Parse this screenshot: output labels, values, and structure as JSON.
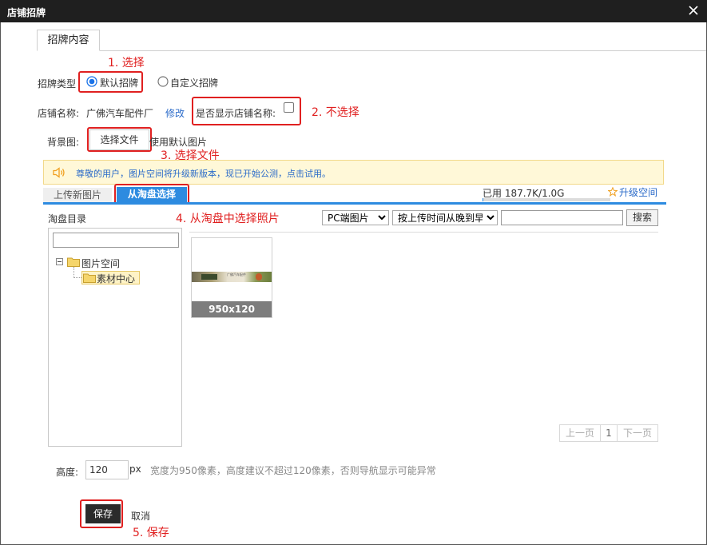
{
  "dialog": {
    "title": "店铺招牌"
  },
  "tabs": {
    "content": "招牌内容"
  },
  "sign_type": {
    "label": "招牌类型",
    "option_default": "默认招牌",
    "option_custom": "自定义招牌"
  },
  "store_name": {
    "label": "店铺名称:",
    "value": "广佛汽车配件厂",
    "edit": "修改",
    "show_label": "是否显示店铺名称:"
  },
  "background": {
    "label": "背景图:",
    "choose_file": "选择文件",
    "use_default": "使用默认图片"
  },
  "notice": {
    "text": "尊敬的用户，图片空间将升级新版本，现已开始公测，点击试用。"
  },
  "subtabs": {
    "upload": "上传新图片",
    "from_taobao": "从淘盘选择"
  },
  "usage": {
    "text": "已用 187.7K/1.0G",
    "fraction": 0.0002,
    "upgrade": "升级空间"
  },
  "directory": {
    "title": "淘盘目录",
    "root": "图片空间",
    "child": "素材中心"
  },
  "filters": {
    "type_selected": "PC端图片",
    "sort_selected": "按上传时间从晚到早",
    "search_button": "搜索"
  },
  "thumbnail": {
    "caption": "950x120",
    "banner_text": "广佛汽车配件"
  },
  "pager": {
    "prev": "上一页",
    "page": "1",
    "next": "下一页"
  },
  "height": {
    "label": "高度:",
    "value": "120",
    "unit": "px",
    "hint": "宽度为950像素，高度建议不超过120像素，否则导航显示可能异常"
  },
  "actions": {
    "save": "保存",
    "cancel": "取消"
  },
  "annotations": {
    "step1": "1. 选择",
    "step2": "2. 不选择",
    "step3": "3. 选择文件",
    "step4": "4. 从淘盘中选择照片",
    "step5": "5. 保存"
  },
  "colors": {
    "annotation": "#e02020",
    "accent": "#2d8be0",
    "link": "#2b6bc9",
    "titlebar": "#1f1f1f"
  }
}
